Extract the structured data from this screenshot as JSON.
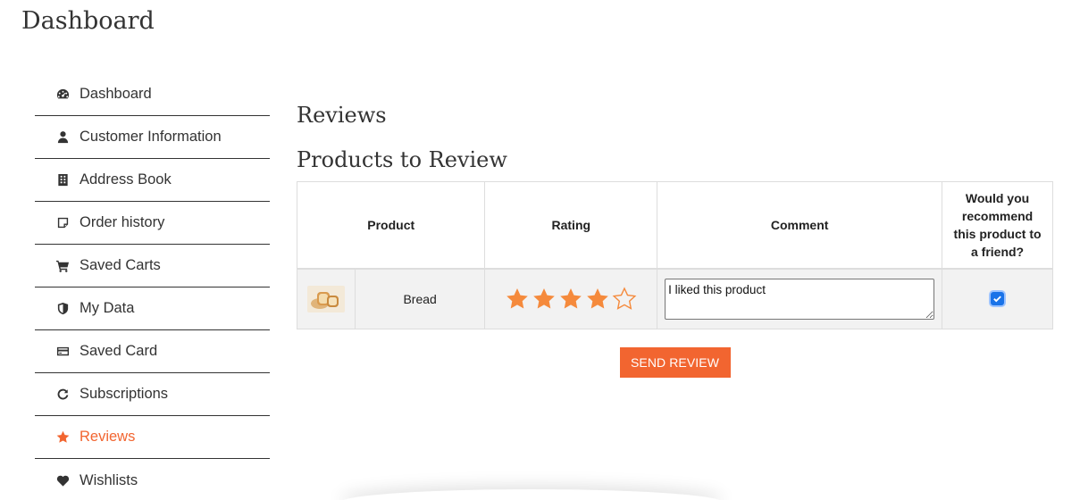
{
  "page": {
    "title": "Dashboard"
  },
  "sidebar": {
    "items": [
      {
        "label": "Dashboard",
        "icon": "dashboard-gauge-icon"
      },
      {
        "label": "Customer Information",
        "icon": "user-icon"
      },
      {
        "label": "Address Book",
        "icon": "address-book-icon"
      },
      {
        "label": "Order history",
        "icon": "note-icon"
      },
      {
        "label": "Saved Carts",
        "icon": "cart-icon"
      },
      {
        "label": "My Data",
        "icon": "shield-icon"
      },
      {
        "label": "Saved Card",
        "icon": "credit-card-icon"
      },
      {
        "label": "Subscriptions",
        "icon": "refresh-icon"
      },
      {
        "label": "Reviews",
        "icon": "star-icon",
        "active": true
      },
      {
        "label": "Wishlists",
        "icon": "heart-icon"
      }
    ]
  },
  "main": {
    "section_title": "Reviews",
    "sub_title": "Products to Review",
    "table": {
      "headers": {
        "product": "Product",
        "rating": "Rating",
        "comment": "Comment",
        "recommend": "Would you recommend this product to a friend?"
      },
      "rows": [
        {
          "product_name": "Bread",
          "thumbnail": "bread-thumbnail",
          "rating": 4,
          "rating_max": 5,
          "comment": "I liked this product",
          "recommend": true
        }
      ]
    },
    "send_button": "SEND REVIEW"
  },
  "colors": {
    "accent": "#f26530",
    "star": "#f58a3c",
    "checkbox": "#1a73e8",
    "row_bg": "#f2f2f2"
  }
}
